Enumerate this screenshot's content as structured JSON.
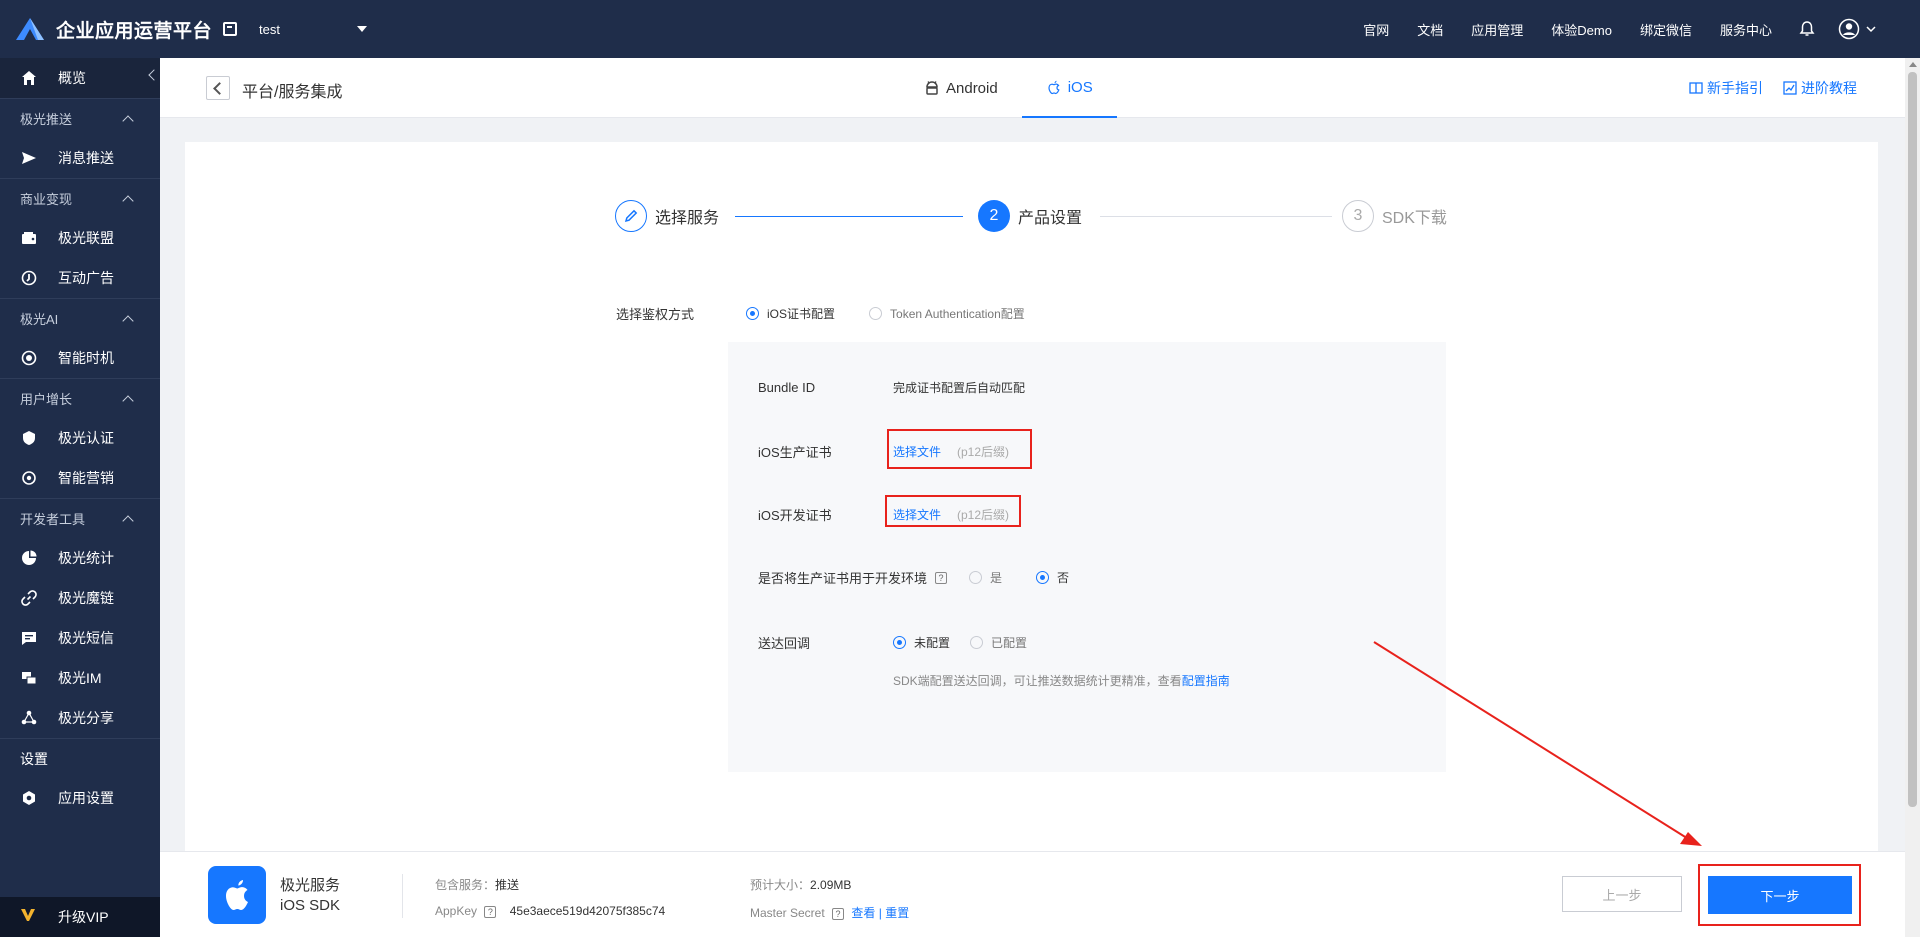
{
  "brand": {
    "title": "企业应用运营平台"
  },
  "app_selector": {
    "name": "test"
  },
  "topnav": [
    "官网",
    "文档",
    "应用管理",
    "体验Demo",
    "绑定微信",
    "服务中心"
  ],
  "sidebar": {
    "items": [
      {
        "type": "item",
        "label": "概览",
        "icon": "home-icon",
        "active": true
      },
      {
        "type": "group",
        "label": "极光推送"
      },
      {
        "type": "item",
        "label": "消息推送",
        "icon": "send-icon"
      },
      {
        "type": "group",
        "label": "商业变现"
      },
      {
        "type": "item",
        "label": "极光联盟",
        "icon": "wallet-icon"
      },
      {
        "type": "item",
        "label": "互动广告",
        "icon": "ad-icon"
      },
      {
        "type": "group",
        "label": "极光AI"
      },
      {
        "type": "item",
        "label": "智能时机",
        "icon": "ai-icon"
      },
      {
        "type": "group",
        "label": "用户增长"
      },
      {
        "type": "item",
        "label": "极光认证",
        "icon": "shield-icon"
      },
      {
        "type": "item",
        "label": "智能营销",
        "icon": "target-icon"
      },
      {
        "type": "group",
        "label": "开发者工具"
      },
      {
        "type": "item",
        "label": "极光统计",
        "icon": "pie-icon"
      },
      {
        "type": "item",
        "label": "极光魔链",
        "icon": "link-icon"
      },
      {
        "type": "item",
        "label": "极光短信",
        "icon": "message-icon"
      },
      {
        "type": "item",
        "label": "极光IM",
        "icon": "chat-icon"
      },
      {
        "type": "item",
        "label": "极光分享",
        "icon": "share-icon"
      },
      {
        "type": "plain",
        "label": "设置"
      },
      {
        "type": "item",
        "label": "应用设置",
        "icon": "gear-icon"
      }
    ],
    "vip": "升级VIP"
  },
  "header": {
    "breadcrumb": "平台/服务集成",
    "tabs": [
      {
        "label": "Android",
        "active": false
      },
      {
        "label": "iOS",
        "active": true
      }
    ],
    "help": [
      "新手指引",
      "进阶教程"
    ]
  },
  "stepper": {
    "steps": [
      {
        "label": "选择服务",
        "state": "done",
        "num": ""
      },
      {
        "label": "产品设置",
        "state": "current",
        "num": "2"
      },
      {
        "label": "SDK下载",
        "state": "todo",
        "num": "3"
      }
    ]
  },
  "form": {
    "auth_label": "选择鉴权方式",
    "auth_options": [
      "iOS证书配置",
      "Token Authentication配置"
    ],
    "bundle_label": "Bundle ID",
    "bundle_value": "完成证书配置后自动匹配",
    "prod_cert_label": "iOS生产证书",
    "dev_cert_label": "iOS开发证书",
    "file_link": "选择文件",
    "file_hint": "(p12后缀)",
    "use_prod_label": "是否将生产证书用于开发环境",
    "yes": "是",
    "no": "否",
    "callback_label": "送达回调",
    "callback_options": [
      "未配置",
      "已配置"
    ],
    "callback_desc": "SDK端配置送达回调，可让推送数据统计更精准，查看",
    "callback_link": "配置指南"
  },
  "footer": {
    "sdk_title": "极光服务",
    "sdk_sub": "iOS SDK",
    "services_label": "包含服务：",
    "services_value": "推送",
    "appkey_label": "AppKey",
    "appkey_value": "45e3aece519d42075f385c74",
    "size_label": "预计大小：",
    "size_value": "2.09MB",
    "secret_label": "Master Secret",
    "secret_view": "查看",
    "secret_sep": "|",
    "secret_reset": "重置",
    "prev": "上一步",
    "next": "下一步"
  },
  "colors": {
    "primary": "#1677ff",
    "nav_bg": "#1f2d4a",
    "annotation": "#e8221c"
  }
}
